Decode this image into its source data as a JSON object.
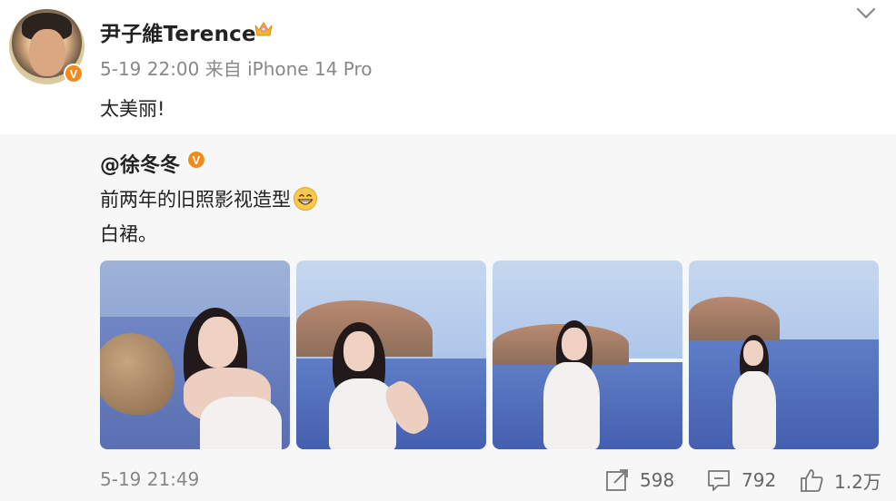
{
  "author": {
    "name": "尹子維Terence",
    "avatar_icon": "avatar",
    "badge": "V"
  },
  "post": {
    "timestamp": "5-19 22:00",
    "source": "来自 iPhone 14 Pro",
    "text": "太美丽!"
  },
  "repost": {
    "user": "@徐冬冬",
    "badge": "V",
    "line1": "前两年的旧照影视造型",
    "line2": "白裙。",
    "photos": [
      "photo-1",
      "photo-2",
      "photo-3",
      "photo-4"
    ]
  },
  "footer": {
    "time": "5-19 21:49",
    "shares": "598",
    "comments": "792",
    "likes": "1.2万"
  },
  "colors": {
    "badge": "#f18b1b",
    "muted": "#888888",
    "repost_bg": "#f7f7f7"
  }
}
